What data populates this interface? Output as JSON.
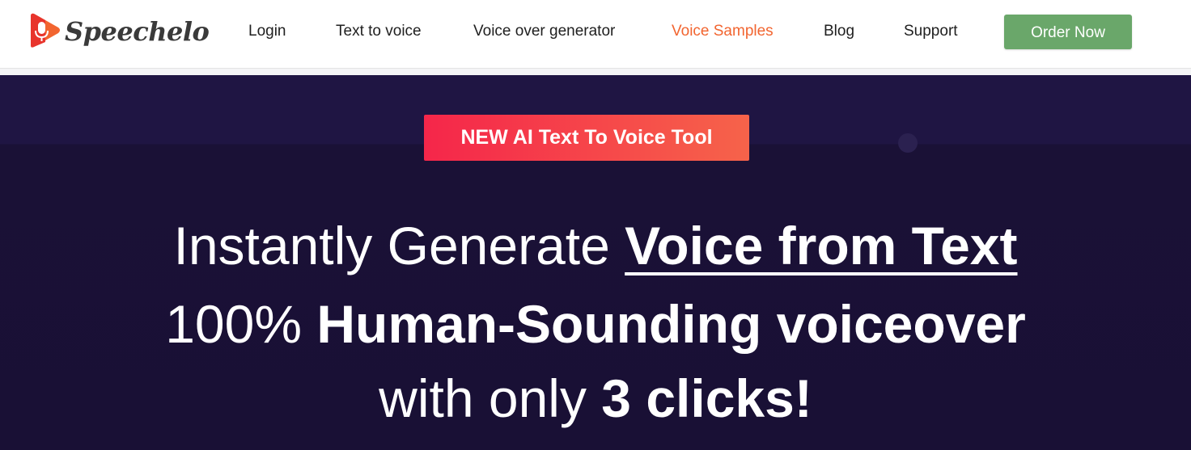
{
  "brand": {
    "name": "Speechelo",
    "icon": "microphone-play-logo-icon",
    "colors": {
      "icon_orange": "#f26530",
      "icon_red": "#e8342c"
    }
  },
  "nav": {
    "links": [
      {
        "label": "Login"
      },
      {
        "label": "Text to voice"
      },
      {
        "label": "Voice over generator"
      },
      {
        "label": "Voice Samples"
      },
      {
        "label": "Blog"
      },
      {
        "label": "Support"
      }
    ],
    "active": "Voice Samples",
    "order_label": "Order Now",
    "colors": {
      "active": "#f26530",
      "order_button": "#6aa76a"
    }
  },
  "hero": {
    "badge": "NEW AI Text To Voice Tool",
    "line1": {
      "light": "Instantly Generate",
      "underlined": "Voice from Text"
    },
    "line2": {
      "light": "100%",
      "bold": "Human-Sounding voiceover"
    },
    "line3": {
      "light": "with only",
      "bold": "3 clicks!"
    },
    "colors": {
      "background": "#1a1136",
      "badge_start": "#f5264a",
      "badge_end": "#f6634a"
    }
  }
}
